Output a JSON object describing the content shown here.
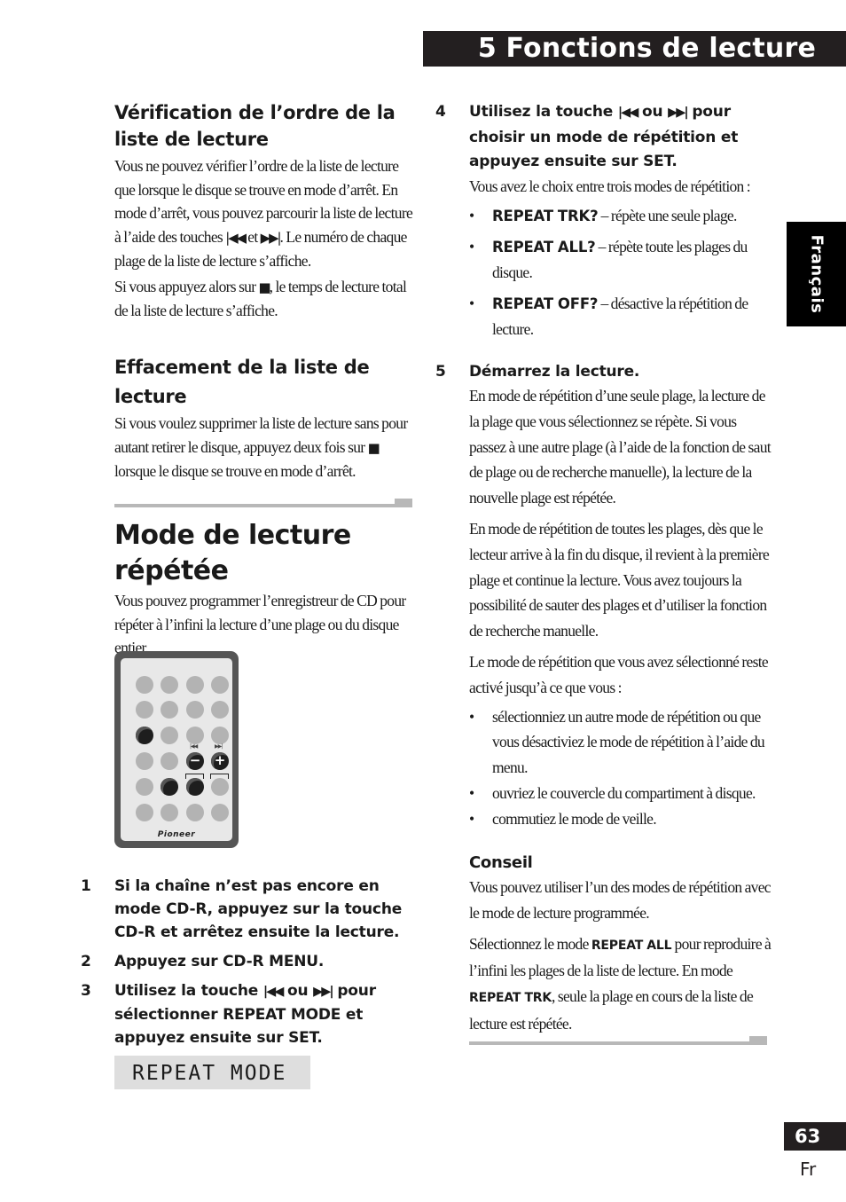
{
  "header": {
    "title": "5  Fonctions de lecture"
  },
  "side_tab": {
    "label": "Français"
  },
  "page": {
    "number": "63",
    "lang": "Fr"
  },
  "icons": {
    "prev": "|◀◀",
    "next": "▶▶|",
    "stop": "■",
    "bullet": "•",
    "minus": "−",
    "plus": "+"
  },
  "left": {
    "section1": {
      "heading": "Vérification de l’ordre de la liste de lecture",
      "p1_a": "Vous ne pouvez vérifier l’ordre de la liste de lecture que lorsque le disque se trouve en mode d’arrêt. En mode d’arrêt, vous pouvez parcourir la liste de lecture à l’aide des touches ",
      "p1_b": " et ",
      "p1_c": ". Le numéro de chaque plage de la liste de lecture s’affiche.",
      "p2_a": "Si vous appuyez alors sur ",
      "p2_b": ", le temps de lecture total de la liste de lecture s’affiche."
    },
    "section2": {
      "heading": "Effacement de la liste de lecture",
      "p1_a": "Si vous voulez supprimer la liste de lecture sans pour autant retirer le disque, appuyez deux fois sur ",
      "p1_b": " lorsque le disque se trouve en mode d’arrêt."
    },
    "section3": {
      "heading": "Mode de lecture répétée",
      "intro": "Vous pouvez programmer l’enregistreur de CD pour répéter à l’infini la lecture d’une plage ou du disque entier."
    },
    "remote": {
      "brand": "Pioneer"
    },
    "steps": [
      {
        "num": "1",
        "text": "Si la chaîne n’est pas encore en mode CD-R, appuyez sur la touche CD-R et arrêtez ensuite la lecture."
      },
      {
        "num": "2",
        "text": "Appuyez sur CD-R MENU."
      },
      {
        "num": "3",
        "text_a": "Utilisez la touche ",
        "text_b": " ou ",
        "text_c": " pour sélectionner REPEAT MODE et appuyez ensuite sur SET."
      }
    ],
    "display": "REPEAT MODE"
  },
  "right": {
    "step4": {
      "num": "4",
      "text_a": "Utilisez la touche ",
      "text_b": " ou ",
      "text_c": " pour choisir un mode de répétition et appuyez ensuite sur SET.",
      "desc": "Vous avez le choix entre trois modes de répétition :",
      "options": [
        {
          "label": "REPEAT TRK?",
          "desc": " – répète une seule plage."
        },
        {
          "label": "REPEAT ALL?",
          "desc": " – répète toute les plages du disque."
        },
        {
          "label": "REPEAT OFF?",
          "desc": " – désactive la répétition de lecture."
        }
      ]
    },
    "step5": {
      "num": "5",
      "title": "Démarrez la lecture.",
      "p1": "En mode de répétition d’une seule plage, la lecture de la plage que vous sélectionnez se répète. Si vous passez à une autre plage (à l’aide de la fonction de saut de plage ou de recherche manuelle), la lecture de la nouvelle plage est répétée.",
      "p2": "En mode de répétition de toutes les plages, dès que le lecteur arrive à la fin du disque, il revient à la première plage et continue la lecture. Vous avez toujours la possibilité de sauter des plages et d’utiliser la fonction de recherche manuelle.",
      "p3": "Le mode de répétition que vous avez sélectionné reste activé jusqu’à ce que vous :",
      "bullets": [
        "sélectionniez un autre mode de répétition ou que vous désactiviez le mode de répétition à l’aide du menu.",
        "ouvriez le couvercle du compartiment à disque.",
        "commutiez le mode de veille."
      ]
    },
    "tip": {
      "heading": "Conseil",
      "p1": "Vous pouvez utiliser l’un des modes de répétition avec le mode de lecture programmée.",
      "p2_a": "Sélectionnez le mode ",
      "p2_b": "REPEAT ALL",
      "p2_c": " pour reproduire à l’infini les plages de la liste de lecture. En mode ",
      "p2_d": "REPEAT TRK",
      "p2_e": ", seule la plage en cours de la liste de lecture est répétée."
    }
  }
}
